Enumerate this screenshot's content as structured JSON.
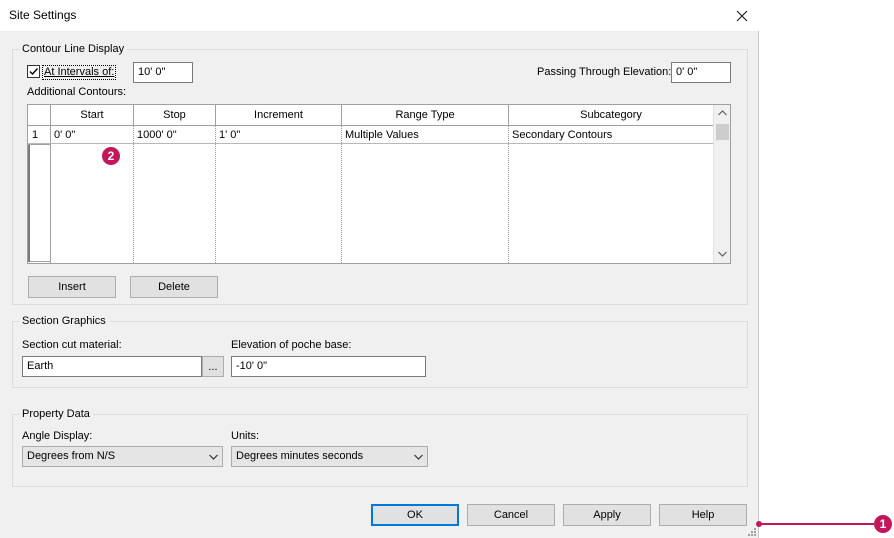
{
  "window": {
    "title": "Site Settings"
  },
  "contour": {
    "group_label": "Contour Line Display",
    "intervals_label": "At Intervals of:",
    "intervals_checked": true,
    "intervals_value": "10'  0\"",
    "passing_label": "Passing Through Elevation:",
    "passing_value": "0'  0\"",
    "additional_label": "Additional Contours:",
    "columns": [
      "Start",
      "Stop",
      "Increment",
      "Range Type",
      "Subcategory"
    ],
    "rows": [
      {
        "num": "1",
        "start": "0'  0\"",
        "stop": "1000'  0\"",
        "increment": "1'  0\"",
        "range_type": "Multiple Values",
        "subcategory": "Secondary Contours"
      }
    ],
    "insert_label": "Insert",
    "delete_label": "Delete"
  },
  "section": {
    "group_label": "Section Graphics",
    "cut_material_label": "Section cut material:",
    "cut_material_value": "Earth",
    "browse_label": "...",
    "poche_label": "Elevation of poche base:",
    "poche_value": "-10'  0\""
  },
  "property": {
    "group_label": "Property Data",
    "angle_label": "Angle Display:",
    "angle_value": "Degrees from N/S",
    "units_label": "Units:",
    "units_value": "Degrees minutes seconds"
  },
  "footer": {
    "ok": "OK",
    "cancel": "Cancel",
    "apply": "Apply",
    "help": "Help"
  },
  "callouts": {
    "one": "1",
    "two": "2"
  },
  "colors": {
    "callout": "#c2185b",
    "focus": "#0078d7"
  },
  "icons": {
    "close": "close-icon",
    "check": "checkmark-icon",
    "dropdown": "chevron-down-icon"
  }
}
